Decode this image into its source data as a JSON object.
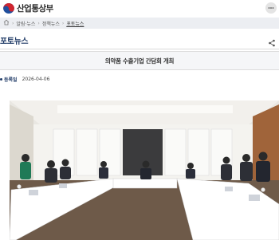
{
  "header": {
    "site_title": "산업통상부",
    "logo_icon": "taegeuk-logo-icon",
    "menu_icon": "more-icon"
  },
  "breadcrumb": {
    "home_icon": "home-icon",
    "items": [
      "알림·뉴스",
      "정책뉴스",
      "포토뉴스"
    ]
  },
  "section": {
    "title": "포토뉴스",
    "share_icon": "share-icon"
  },
  "article": {
    "title": "의약품 수출기업 간담회 개최",
    "date_label": "등록일",
    "date_value": "2026-04-06"
  },
  "colors": {
    "brand_navy": "#1f3a66",
    "crumb_bg": "#eceef2",
    "title_box_bg": "#f5f6f8"
  }
}
